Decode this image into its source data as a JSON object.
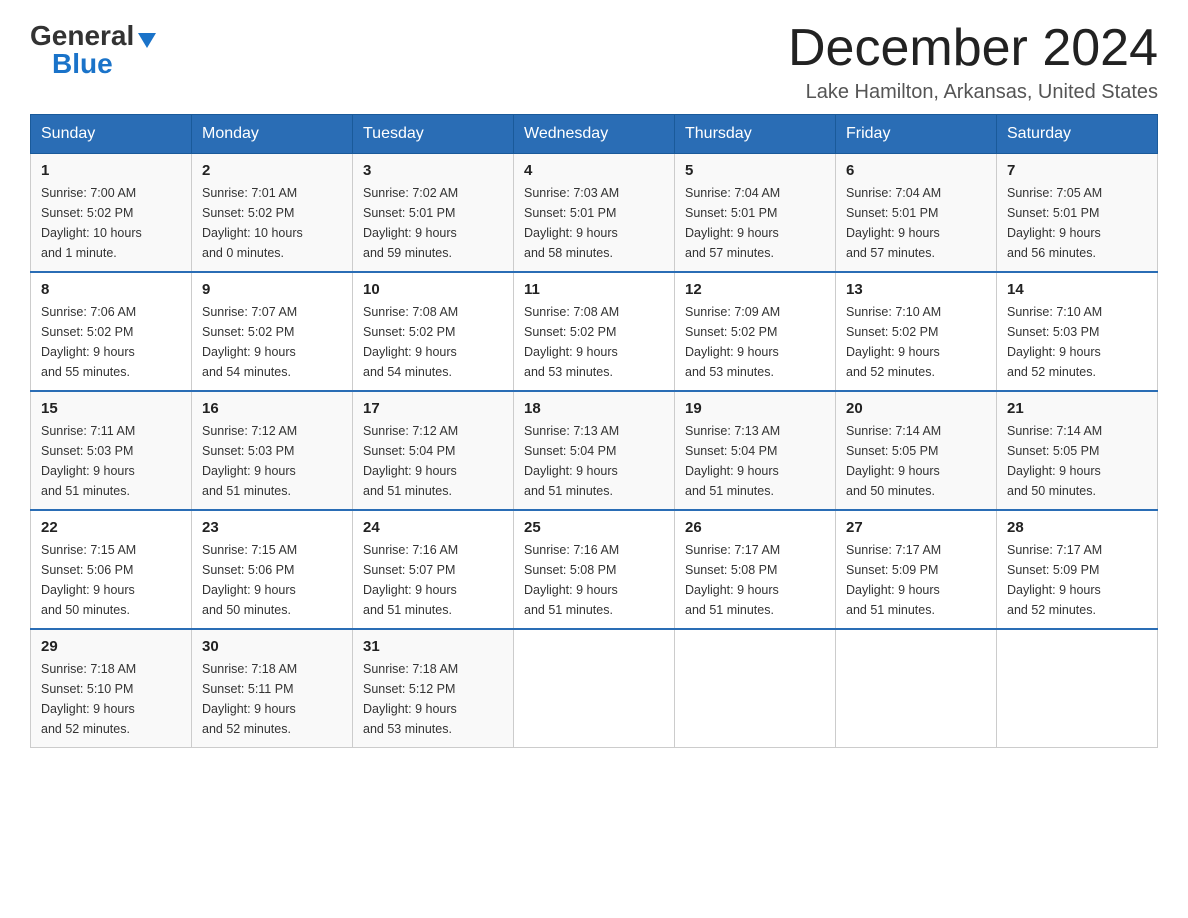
{
  "logo": {
    "general": "General",
    "blue": "Blue",
    "triangle": "▶"
  },
  "title": "December 2024",
  "subtitle": "Lake Hamilton, Arkansas, United States",
  "weekdays": [
    "Sunday",
    "Monday",
    "Tuesday",
    "Wednesday",
    "Thursday",
    "Friday",
    "Saturday"
  ],
  "weeks": [
    [
      {
        "day": "1",
        "sunrise": "7:00 AM",
        "sunset": "5:02 PM",
        "daylight": "10 hours and 1 minute."
      },
      {
        "day": "2",
        "sunrise": "7:01 AM",
        "sunset": "5:02 PM",
        "daylight": "10 hours and 0 minutes."
      },
      {
        "day": "3",
        "sunrise": "7:02 AM",
        "sunset": "5:01 PM",
        "daylight": "9 hours and 59 minutes."
      },
      {
        "day": "4",
        "sunrise": "7:03 AM",
        "sunset": "5:01 PM",
        "daylight": "9 hours and 58 minutes."
      },
      {
        "day": "5",
        "sunrise": "7:04 AM",
        "sunset": "5:01 PM",
        "daylight": "9 hours and 57 minutes."
      },
      {
        "day": "6",
        "sunrise": "7:04 AM",
        "sunset": "5:01 PM",
        "daylight": "9 hours and 57 minutes."
      },
      {
        "day": "7",
        "sunrise": "7:05 AM",
        "sunset": "5:01 PM",
        "daylight": "9 hours and 56 minutes."
      }
    ],
    [
      {
        "day": "8",
        "sunrise": "7:06 AM",
        "sunset": "5:02 PM",
        "daylight": "9 hours and 55 minutes."
      },
      {
        "day": "9",
        "sunrise": "7:07 AM",
        "sunset": "5:02 PM",
        "daylight": "9 hours and 54 minutes."
      },
      {
        "day": "10",
        "sunrise": "7:08 AM",
        "sunset": "5:02 PM",
        "daylight": "9 hours and 54 minutes."
      },
      {
        "day": "11",
        "sunrise": "7:08 AM",
        "sunset": "5:02 PM",
        "daylight": "9 hours and 53 minutes."
      },
      {
        "day": "12",
        "sunrise": "7:09 AM",
        "sunset": "5:02 PM",
        "daylight": "9 hours and 53 minutes."
      },
      {
        "day": "13",
        "sunrise": "7:10 AM",
        "sunset": "5:02 PM",
        "daylight": "9 hours and 52 minutes."
      },
      {
        "day": "14",
        "sunrise": "7:10 AM",
        "sunset": "5:03 PM",
        "daylight": "9 hours and 52 minutes."
      }
    ],
    [
      {
        "day": "15",
        "sunrise": "7:11 AM",
        "sunset": "5:03 PM",
        "daylight": "9 hours and 51 minutes."
      },
      {
        "day": "16",
        "sunrise": "7:12 AM",
        "sunset": "5:03 PM",
        "daylight": "9 hours and 51 minutes."
      },
      {
        "day": "17",
        "sunrise": "7:12 AM",
        "sunset": "5:04 PM",
        "daylight": "9 hours and 51 minutes."
      },
      {
        "day": "18",
        "sunrise": "7:13 AM",
        "sunset": "5:04 PM",
        "daylight": "9 hours and 51 minutes."
      },
      {
        "day": "19",
        "sunrise": "7:13 AM",
        "sunset": "5:04 PM",
        "daylight": "9 hours and 51 minutes."
      },
      {
        "day": "20",
        "sunrise": "7:14 AM",
        "sunset": "5:05 PM",
        "daylight": "9 hours and 50 minutes."
      },
      {
        "day": "21",
        "sunrise": "7:14 AM",
        "sunset": "5:05 PM",
        "daylight": "9 hours and 50 minutes."
      }
    ],
    [
      {
        "day": "22",
        "sunrise": "7:15 AM",
        "sunset": "5:06 PM",
        "daylight": "9 hours and 50 minutes."
      },
      {
        "day": "23",
        "sunrise": "7:15 AM",
        "sunset": "5:06 PM",
        "daylight": "9 hours and 50 minutes."
      },
      {
        "day": "24",
        "sunrise": "7:16 AM",
        "sunset": "5:07 PM",
        "daylight": "9 hours and 51 minutes."
      },
      {
        "day": "25",
        "sunrise": "7:16 AM",
        "sunset": "5:08 PM",
        "daylight": "9 hours and 51 minutes."
      },
      {
        "day": "26",
        "sunrise": "7:17 AM",
        "sunset": "5:08 PM",
        "daylight": "9 hours and 51 minutes."
      },
      {
        "day": "27",
        "sunrise": "7:17 AM",
        "sunset": "5:09 PM",
        "daylight": "9 hours and 51 minutes."
      },
      {
        "day": "28",
        "sunrise": "7:17 AM",
        "sunset": "5:09 PM",
        "daylight": "9 hours and 52 minutes."
      }
    ],
    [
      {
        "day": "29",
        "sunrise": "7:18 AM",
        "sunset": "5:10 PM",
        "daylight": "9 hours and 52 minutes."
      },
      {
        "day": "30",
        "sunrise": "7:18 AM",
        "sunset": "5:11 PM",
        "daylight": "9 hours and 52 minutes."
      },
      {
        "day": "31",
        "sunrise": "7:18 AM",
        "sunset": "5:12 PM",
        "daylight": "9 hours and 53 minutes."
      },
      null,
      null,
      null,
      null
    ]
  ],
  "labels": {
    "sunrise": "Sunrise:",
    "sunset": "Sunset:",
    "daylight": "Daylight:"
  }
}
